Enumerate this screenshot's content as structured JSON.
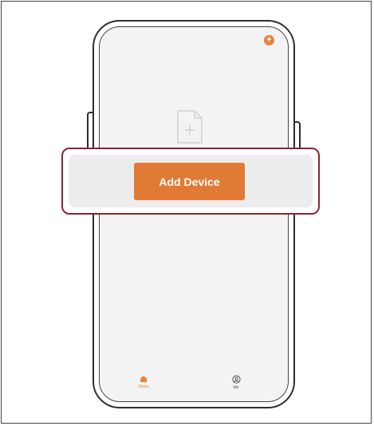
{
  "main": {
    "add_device_label": "Add Device",
    "add_icon": "plus-circle-icon",
    "empty_icon": "add-document-icon"
  },
  "tabs": [
    {
      "label": "Home",
      "icon": "home-icon",
      "active": true
    },
    {
      "label": "Me",
      "icon": "profile-icon",
      "active": false
    }
  ],
  "colors": {
    "accent": "#e17a34",
    "highlight_border": "#8a2530",
    "screen_bg": "#f3f3f3"
  }
}
